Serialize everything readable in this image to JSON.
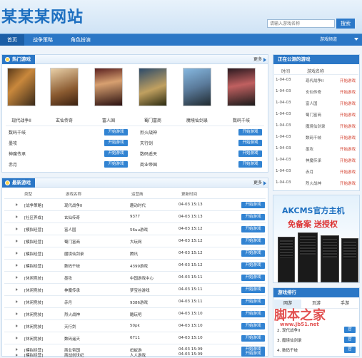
{
  "site": {
    "logo": "某某某网站",
    "search_placeholder": "请输入游戏名称",
    "search_button": "搜索"
  },
  "nav": {
    "items": [
      "首页",
      "战争策略",
      "角色扮演"
    ],
    "right": "游戏频道"
  },
  "hot": {
    "title": "热门游戏",
    "more": "更多",
    "cards": [
      "现代战争II",
      "玄仙传奇",
      "富人国",
      "蜀门富商",
      "魔境仙剑录",
      "数码千岐"
    ],
    "list_left": [
      "数码千岐",
      "墨攻",
      "神魔传承",
      "赤月"
    ],
    "list_right": [
      "烈火战神",
      "天行剑",
      "数码遥天",
      "商业帝国"
    ],
    "button": "开始游戏"
  },
  "online": {
    "title": "正在公测的游戏",
    "headers": [
      "时间",
      "游戏名称"
    ],
    "rows": [
      [
        "1-04-03",
        "现代战争II",
        "开始游戏"
      ],
      [
        "1-04-03",
        "玄仙传奇",
        "开始游戏"
      ],
      [
        "1-04-03",
        "富人国",
        "开始游戏"
      ],
      [
        "1-04-03",
        "蜀门富商",
        "开始游戏"
      ],
      [
        "1-04-03",
        "魔境仙剑录",
        "开始游戏"
      ],
      [
        "1-04-03",
        "数码千岐",
        "开始游戏"
      ],
      [
        "1-04-03",
        "墨攻",
        "开始游戏"
      ],
      [
        "1-04-03",
        "神魔传承",
        "开始游戏"
      ],
      [
        "1-04-03",
        "赤月",
        "开始游戏"
      ],
      [
        "1-04-03",
        "烈火战神",
        "开始游戏"
      ]
    ]
  },
  "latest": {
    "title": "最新游戏",
    "more": "更多",
    "headers": [
      "类型",
      "游戏名称",
      "运营商",
      "更新时间"
    ],
    "rows": [
      [
        "[战争策略]",
        "现代战争II",
        "趣动时代",
        "04-03 15:13",
        "开始游戏"
      ],
      [
        "[社区养成]",
        "玄仙传奇",
        "9377",
        "04-03 15:13",
        "开始游戏"
      ],
      [
        "[模拟经营]",
        "富人国",
        "56uu游戏",
        "04-03 15:12",
        "开始游戏"
      ],
      [
        "[模拟经营]",
        "蜀门富商",
        "大玩网",
        "04-03 15:12",
        "开始游戏"
      ],
      [
        "[模拟经营]",
        "魔境仙剑录",
        "腾讯",
        "04-03 15:12",
        "开始游戏"
      ],
      [
        "[模拟经营]",
        "数码千岐",
        "4399游戏",
        "04-03 15:12",
        "开始游戏"
      ],
      [
        "[休闲竞技]",
        "墨攻",
        "中国游戏中心",
        "04-03 15:11",
        "开始游戏"
      ],
      [
        "[休闲竞技]",
        "神魔传承",
        "梦宝谷游戏",
        "04-03 15:11",
        "开始游戏"
      ],
      [
        "[休闲竞技]",
        "赤月",
        "9386游戏",
        "04-03 15:11",
        "开始游戏"
      ],
      [
        "[休闲竞技]",
        "烈火战神",
        "酷玩吧",
        "04-03 15:10",
        "开始游戏"
      ],
      [
        "[休闲竞技]",
        "天行剑",
        "50pk",
        "04-03 15:10",
        "开始游戏"
      ],
      [
        "[休闲竞技]",
        "数码遥天",
        "6711",
        "04-03 15:10",
        "开始游戏"
      ],
      [
        "[模拟经营]",
        "商业帝国",
        "蚂蚁游",
        "04-03 15:09",
        "开始游戏"
      ],
      [
        "[模拟经营]",
        "商战创世纪",
        "人人游戏",
        "04-03 15:09",
        "开始游戏"
      ]
    ]
  },
  "ad": {
    "title": "AKCMS官方主机",
    "subtitle": "免备案 送授权"
  },
  "rank": {
    "title": "游戏排行",
    "tabs": [
      "网游",
      "页游",
      "手游"
    ],
    "items": [
      "2. 现代战争II",
      "3. 魔境仙剑录",
      "4. 数码千岐"
    ],
    "tag": "官"
  },
  "watermark": {
    "cn": "脚本之家",
    "url": "www.Jb51.net"
  },
  "colors": {
    "primary": "#2b77c6",
    "link_red": "#d23c2a",
    "bg": "#eef4fa"
  }
}
